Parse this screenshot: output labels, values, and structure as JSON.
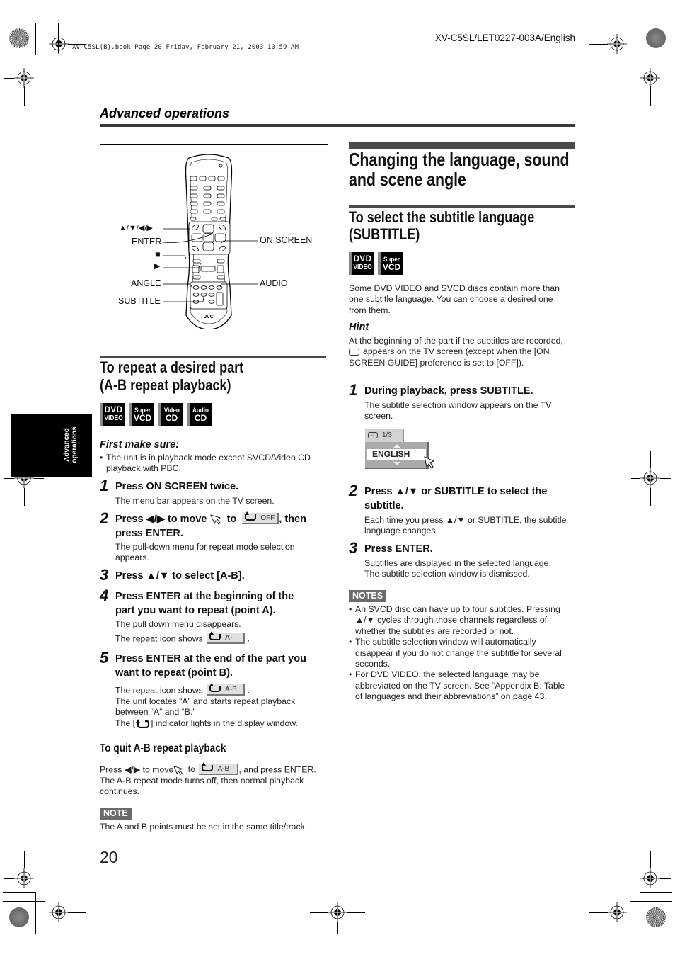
{
  "slug": "XV-C5SL(B).book  Page 20  Friday, February 21, 2003  10:59 AM",
  "doc_id": "XV-C5SL/LET0227-003A/English",
  "section_header": "Advanced operations",
  "side_tab": {
    "line1": "Advanced",
    "line2": "operations"
  },
  "remote_figure": {
    "brand": "JVC",
    "labels": {
      "arrows": "▲/▼/◀/▶",
      "enter": "ENTER",
      "stop": "■",
      "play": "▶",
      "angle": "ANGLE",
      "subtitle": "SUBTITLE",
      "on_screen": "ON SCREEN",
      "audio": "AUDIO"
    }
  },
  "left": {
    "title_line1": "To repeat a desired part",
    "title_line2": "(A-B repeat playback)",
    "badges": [
      {
        "line1": "DVD",
        "line2": "VIDEO",
        "icon": "dvd-video-badge"
      },
      {
        "line1": "Super",
        "line2": "VCD",
        "icon": "super-vcd-badge"
      },
      {
        "line1": "Video",
        "line2": "CD",
        "icon": "video-cd-badge"
      },
      {
        "line1": "Audio",
        "line2": "CD",
        "icon": "audio-cd-badge"
      }
    ],
    "first_make_sure": "First make sure:",
    "prereq": "The unit is in playback mode except SVCD/Video CD playback with PBC.",
    "steps": [
      {
        "num": "1",
        "title": "Press ON SCREEN twice.",
        "body": "The menu bar appears on the TV screen."
      },
      {
        "num": "2",
        "title_a": "Press ◀/▶ to move",
        "title_b": "to",
        "title_c": ", then",
        "title_d": "press ENTER.",
        "osd": "OFF",
        "body": "The pull-down menu for repeat mode selection appears."
      },
      {
        "num": "3",
        "title": "Press ▲/▼ to select [A-B]."
      },
      {
        "num": "4",
        "title_line1": "Press ENTER at the beginning of the",
        "title_line2": "part you want to repeat (point A).",
        "body1": "The pull down menu disappears.",
        "body2": "The repeat icon shows",
        "osd": "A-"
      },
      {
        "num": "5",
        "title_line1": "Press ENTER at the end of the part you",
        "title_line2": "want to repeat (point B).",
        "body1": "The repeat icon shows",
        "osd": "A-B",
        "body2": "The unit locates “A” and starts repeat playback",
        "body3": "between “A” and “B.”",
        "body4a": "The [",
        "body4b": "] indicator lights in the display window."
      }
    ],
    "quit": {
      "heading": "To quit A-B repeat playback",
      "line1a": "Press ◀/▶ to move",
      "line1b": "to",
      "line1c": ", and press ENTER.",
      "osd": "A-B",
      "line2": "The A-B repeat mode turns off, then normal playback",
      "line3": "continues."
    },
    "note_tag": "NOTE",
    "note": "The A and B points must be set in the same title/track."
  },
  "right": {
    "title_line1": "Changing the language, sound",
    "title_line2": "and scene angle",
    "sub_title_line1": "To select the subtitle language",
    "sub_title_line2": "(SUBTITLE)",
    "badges": [
      {
        "line1": "DVD",
        "line2": "VIDEO",
        "icon": "dvd-video-badge"
      },
      {
        "line1": "Super",
        "line2": "VCD",
        "icon": "super-vcd-badge"
      }
    ],
    "intro": [
      "Some DVD VIDEO and SVCD discs contain more than",
      "one subtitle language. You can choose a desired one",
      "from them."
    ],
    "hint_heading": "Hint",
    "hint": [
      "At the beginning of the part if the subtitles are recorded,",
      "appears on the TV screen (except when the [ON",
      "SCREEN GUIDE] preference is set to [OFF])."
    ],
    "steps": [
      {
        "num": "1",
        "title": "During playback, press SUBTITLE.",
        "body": [
          "The subtitle selection window appears on the TV",
          "screen."
        ]
      },
      {
        "num": "2",
        "title_line1": "Press ▲/▼ or SUBTITLE to select the",
        "title_line2": "subtitle.",
        "body": [
          "Each time you press ▲/▼ or SUBTITLE, the subtitle",
          "language changes."
        ]
      },
      {
        "num": "3",
        "title": "Press ENTER.",
        "body": [
          "Subtitles are displayed in the selected language.",
          "The subtitle selection window is dismissed."
        ]
      }
    ],
    "subtitle_window": {
      "counter": "1/3",
      "selected": "ENGLISH"
    },
    "notes_tag": "NOTES",
    "notes": [
      [
        "An SVCD disc can have up to four subtitles. Pressing",
        "▲/▼ cycles through those channels regardless of",
        "whether the subtitles are recorded or not."
      ],
      [
        "The subtitle selection window will automatically",
        "disappear if you do not change the subtitle for several",
        "seconds."
      ],
      [
        "For DVD VIDEO, the selected language may be",
        "abbreviated on the TV screen. See “Appendix B: Table",
        "of languages and their abbreviations” on page 43."
      ]
    ]
  },
  "page_number": "20"
}
